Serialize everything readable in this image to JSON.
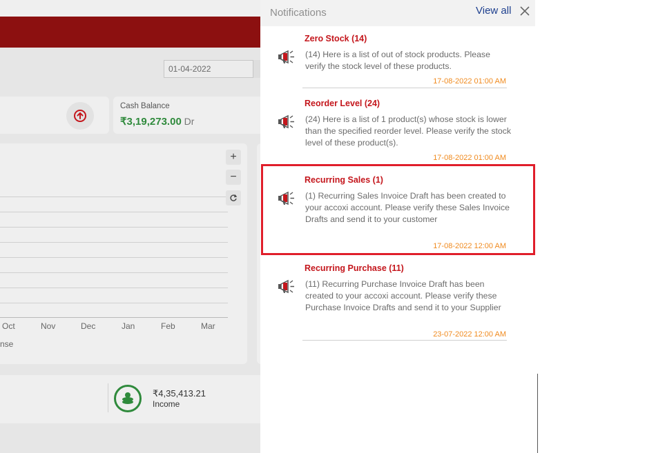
{
  "background": {
    "date_value": "01-04-2022",
    "cash_balance_label": "Cash Balance",
    "cash_balance_value": "₹3,19,273.00",
    "cash_balance_suffix": " Dr",
    "chart_months": [
      "Oct",
      "Nov",
      "Dec",
      "Jan",
      "Feb",
      "Mar"
    ],
    "legend_fragment": "nse",
    "zoom_in": "+",
    "zoom_out": "−",
    "income_value": "₹4,35,413.21",
    "income_label": "Income"
  },
  "panel": {
    "title": "Notifications",
    "view_all": "View all"
  },
  "notifications": [
    {
      "title": "Zero Stock (14)",
      "body": "(14) Here is a list of out of stock products. Please verify the stock level of these products.",
      "time": "17-08-2022 01:00 AM"
    },
    {
      "title": "Reorder Level (24)",
      "body": "(24) Here is a list of 1 product(s) whose stock is lower than the specified reorder level. Please verify the stock level of these product(s).",
      "time": "17-08-2022 01:00 AM"
    },
    {
      "title": "Recurring Sales (1)",
      "body": "(1) Recurring Sales Invoice Draft has been created to your accoxi account. Please verify these Sales Invoice  Drafts and send it to your customer",
      "time": "17-08-2022 12:00 AM"
    },
    {
      "title": "Recurring Purchase (11)",
      "body": "(11) Recurring Purchase Invoice Draft has been created to your accoxi account. Please verify these Purchase Invoice  Drafts and send it to your Supplier",
      "time": "23-07-2022 12:00 AM"
    }
  ],
  "colors": {
    "accent_red": "#c4161c",
    "highlight_border": "#e01e2a",
    "timestamp_orange": "#f08a1e",
    "link_blue": "#1d3f8e",
    "positive_green": "#2f8a3c"
  },
  "icons": {
    "notification": "megaphone-icon",
    "close": "close-icon",
    "cash_flow": "arrow-up-circle-icon",
    "refresh": "refresh-icon",
    "income": "coins-icon"
  }
}
